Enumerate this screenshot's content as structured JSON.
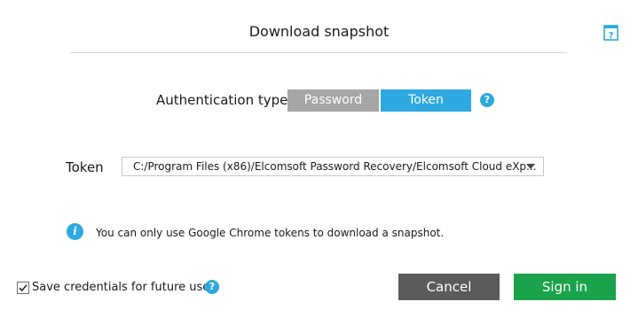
{
  "dialog": {
    "title": "Download snapshot"
  },
  "auth": {
    "label": "Authentication type",
    "options": [
      {
        "label": "Password",
        "selected": false
      },
      {
        "label": "Token",
        "selected": true
      }
    ]
  },
  "token": {
    "label": "Token",
    "value": "C:/Program Files (x86)/Elcomsoft Password Recovery/Elcomsoft Cloud eXp..."
  },
  "info": {
    "icon_glyph": "i",
    "text": "You can only use Google Chrome tokens to download a snapshot."
  },
  "save": {
    "label": "Save credentials for future use",
    "checked": true
  },
  "help_glyph": "?",
  "buttons": {
    "cancel": "Cancel",
    "sign_in": "Sign in"
  },
  "colors": {
    "accent_blue": "#2ea8e0",
    "unselected_gray": "#a6a6a6",
    "cancel_gray": "#5b5b5b",
    "sign_in_green": "#1aa34a"
  }
}
